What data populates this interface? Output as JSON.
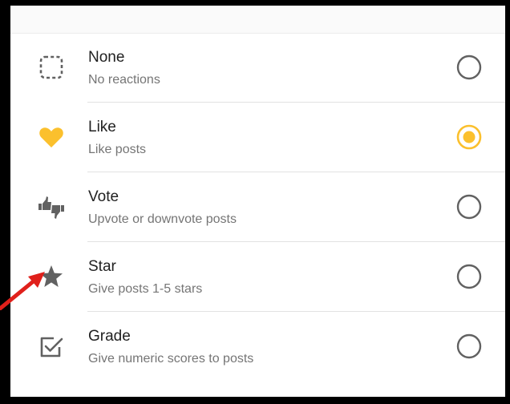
{
  "options": [
    {
      "title": "None",
      "subtitle": "No reactions",
      "icon": "dashed-square-icon",
      "selected": false
    },
    {
      "title": "Like",
      "subtitle": "Like posts",
      "icon": "heart-icon",
      "selected": true
    },
    {
      "title": "Vote",
      "subtitle": "Upvote or downvote posts",
      "icon": "thumbs-vote-icon",
      "selected": false
    },
    {
      "title": "Star",
      "subtitle": "Give posts 1-5 stars",
      "icon": "star-icon",
      "selected": false
    },
    {
      "title": "Grade",
      "subtitle": "Give numeric scores to posts",
      "icon": "checkbox-icon",
      "selected": false
    }
  ],
  "colors": {
    "accent": "#fbc02d",
    "icon_gray": "#616161",
    "radio_gray": "#616161",
    "annotation_arrow": "#e0201b",
    "frame": "#000000"
  }
}
